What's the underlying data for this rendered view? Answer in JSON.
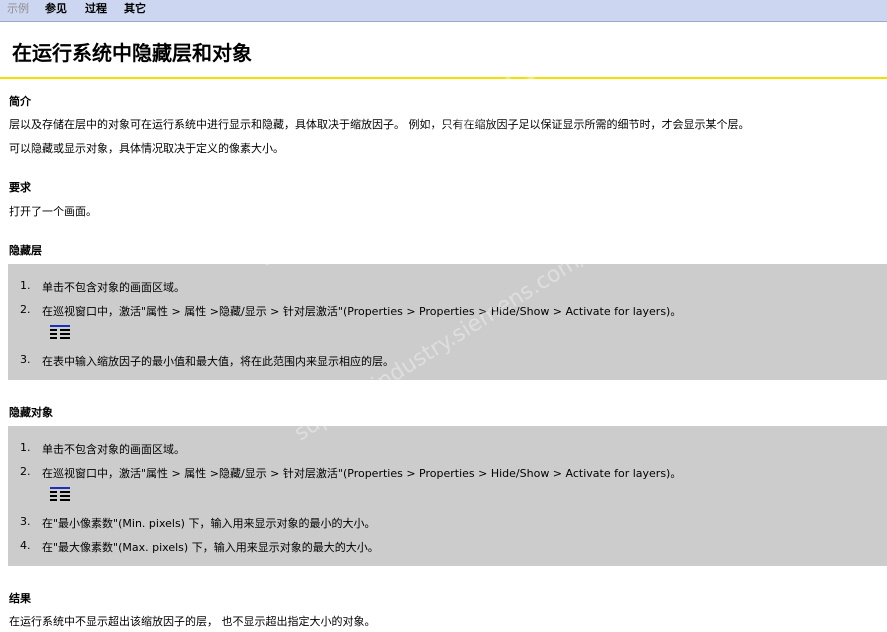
{
  "nav": {
    "example": "示例",
    "see_also": "参见",
    "procedure": "过程",
    "other": "其它"
  },
  "title": "在运行系统中隐藏层和对象",
  "intro": {
    "heading": "简介",
    "line1": "层以及存储在层中的对象可在运行系统中进行显示和隐藏，具体取决于缩放因子。 例如，只有在缩放因子足以保证显示所需的细节时，才会显示某个层。",
    "line2": "可以隐藏或显示对象，具体情况取决于定义的像素大小。"
  },
  "requirement": {
    "heading": "要求",
    "text": "打开了一个画面。"
  },
  "hide_layers": {
    "heading": "隐藏层",
    "steps": [
      {
        "num": "1.",
        "text": "单击不包含对象的画面区域。"
      },
      {
        "num": "2.",
        "text": "在巡视窗口中，激活\"属性 > 属性 >隐藏/显示 > 针对层激活\"(Properties > Properties > Hide/Show > Activate for layers)。"
      },
      {
        "num": "3.",
        "text": "在表中输入缩放因子的最小值和最大值，将在此范围内来显示相应的层。"
      }
    ]
  },
  "hide_objects": {
    "heading": "隐藏对象",
    "steps": [
      {
        "num": "1.",
        "text": "单击不包含对象的画面区域。"
      },
      {
        "num": "2.",
        "text": "在巡视窗口中，激活\"属性 > 属性 >隐藏/显示 > 针对层激活\"(Properties > Properties > Hide/Show > Activate for layers)。"
      },
      {
        "num": "3.",
        "text": "在\"最小像素数\"(Min. pixels) 下，输入用来显示对象的最小的大小。"
      },
      {
        "num": "4.",
        "text": "在\"最大像素数\"(Max. pixels) 下，输入用来显示对象的最大的大小。"
      }
    ]
  },
  "result": {
    "heading": "结果",
    "text": "在运行系统中不显示超出该缩放因子的层， 也不显示超出指定大小的对象。"
  },
  "watermark": {
    "line1": "西门子工业 技术论坛",
    "line2": "support.industry.siemens.com/cs"
  },
  "icon": "properties-list-icon"
}
